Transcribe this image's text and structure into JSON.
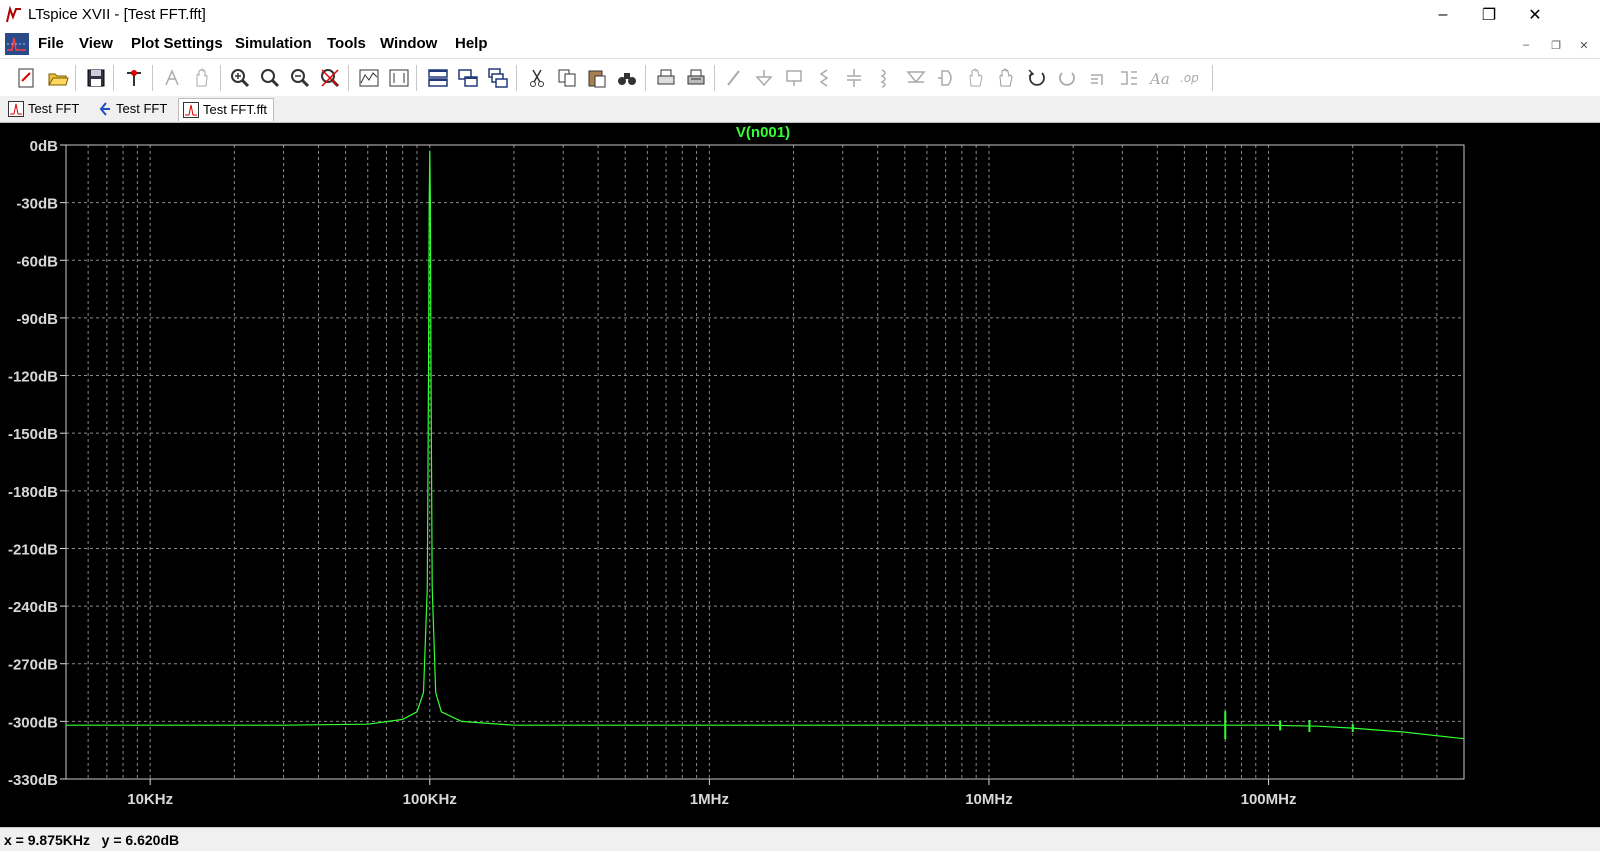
{
  "window": {
    "title": "LTspice XVII - [Test FFT.fft]",
    "controls": {
      "minimize": "–",
      "restore": "❐",
      "close": "✕"
    }
  },
  "menu": {
    "items": [
      "File",
      "View",
      "Plot Settings",
      "Simulation",
      "Tools",
      "Window",
      "Help"
    ],
    "mdi_controls": {
      "minimize": "–",
      "restore": "❐",
      "close": "✕"
    }
  },
  "toolbar": {
    "icons": [
      "new-schematic-icon",
      "open-icon",
      "save-icon",
      "control-panel-icon",
      "run-icon",
      "halt-icon",
      "zoom-in-icon",
      "zoom-full-icon",
      "zoom-out-icon",
      "zoom-cancel-icon",
      "autorange-icon",
      "annotation-icon",
      "tile-horizontal-icon",
      "tile-vertical-icon",
      "cascade-icon",
      "cut-icon",
      "copy-icon",
      "paste-icon",
      "find-icon",
      "print-preview-icon",
      "print-icon",
      "wire-icon",
      "ground-icon",
      "label-icon",
      "resistor-icon",
      "capacitor-icon",
      "inductor-icon",
      "diode-icon",
      "component-icon",
      "move-icon",
      "drag-icon",
      "undo-icon",
      "redo-icon",
      "rotate-icon",
      "mirror-icon",
      "text-icon",
      "spice-directive-icon"
    ]
  },
  "tabs": [
    {
      "label": "Test FFT",
      "icon": "waveform-icon"
    },
    {
      "label": "Test FFT",
      "icon": "schematic-icon"
    },
    {
      "label": "Test FFT.fft",
      "icon": "waveform-icon",
      "active": true
    }
  ],
  "status": {
    "x": "x = 9.875KHz",
    "y": "y = 6.620dB"
  },
  "colors": {
    "trace": "#33ff33",
    "grid": "#8a8a8a",
    "plot_background": "#000000",
    "axis_labels": "#d8d8d8"
  },
  "chart_data": {
    "type": "line",
    "title": "V(n001)",
    "xlabel": "",
    "ylabel": "",
    "x_scale": "log",
    "xlim": [
      5000,
      500000000
    ],
    "ylim": [
      -330,
      0
    ],
    "x_ticks": [
      {
        "value": 10000,
        "label": "10KHz"
      },
      {
        "value": 100000,
        "label": "100KHz"
      },
      {
        "value": 1000000,
        "label": "1MHz"
      },
      {
        "value": 10000000,
        "label": "10MHz"
      },
      {
        "value": 100000000,
        "label": "100MHz"
      }
    ],
    "y_ticks": [
      {
        "value": 0,
        "label": "0dB"
      },
      {
        "value": -30,
        "label": "-30dB"
      },
      {
        "value": -60,
        "label": "-60dB"
      },
      {
        "value": -90,
        "label": "-90dB"
      },
      {
        "value": -120,
        "label": "-120dB"
      },
      {
        "value": -150,
        "label": "-150dB"
      },
      {
        "value": -180,
        "label": "-180dB"
      },
      {
        "value": -210,
        "label": "-210dB"
      },
      {
        "value": -240,
        "label": "-240dB"
      },
      {
        "value": -270,
        "label": "-270dB"
      },
      {
        "value": -300,
        "label": "-300dB"
      },
      {
        "value": -330,
        "label": "-330dB"
      }
    ],
    "grid": true,
    "series": [
      {
        "name": "V(n001)",
        "color": "#33ff33",
        "points": [
          [
            5000,
            -302
          ],
          [
            10000,
            -302
          ],
          [
            30000,
            -302
          ],
          [
            60000,
            -301.5
          ],
          [
            80000,
            -299
          ],
          [
            90000,
            -295
          ],
          [
            95000,
            -285
          ],
          [
            98000,
            -230
          ],
          [
            99000,
            -120
          ],
          [
            99500,
            -30
          ],
          [
            100000,
            -3
          ],
          [
            100500,
            -30
          ],
          [
            101000,
            -120
          ],
          [
            102000,
            -230
          ],
          [
            105000,
            -285
          ],
          [
            110000,
            -295
          ],
          [
            130000,
            -300
          ],
          [
            200000,
            -302
          ],
          [
            1000000,
            -302
          ],
          [
            10000000,
            -302
          ],
          [
            50000000,
            -302
          ],
          [
            100000000,
            -302
          ],
          [
            150000000,
            -302.5
          ],
          [
            200000000,
            -303.5
          ],
          [
            300000000,
            -305.5
          ],
          [
            500000000,
            -309
          ]
        ]
      }
    ]
  }
}
